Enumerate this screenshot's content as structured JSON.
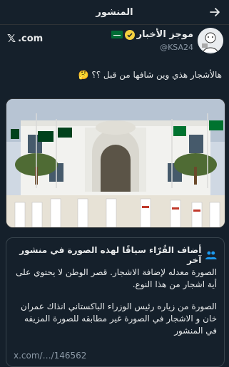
{
  "topbar": {
    "title": "المنشور"
  },
  "author": {
    "name": "موجز الأخبار",
    "handle": "@KSA24"
  },
  "xlink": {
    "label": ".com"
  },
  "tweet": {
    "text": "هالأشجار هذي وين شافها من قبل ؟؟ 🤔"
  },
  "note": {
    "title": "أضاف القُرّاء سياقًا لهذه الصورة في منشور آخر",
    "paragraph1": "الصورة معدله لإضافة الاشجار. قصر الوطن لا يحتوي على أية اشجار من هذا النوع.",
    "paragraph2": "الصورة من زياره رئيس الوزراء الباكستاني انذاك عمران خان و الاشجار في الصورة غير مطابقه للصورة المزيفه في المنشور",
    "link": "x.com/…/146562"
  },
  "colors": {
    "background": "#15202b",
    "text": "#e7e9ea",
    "muted": "#8b98a5",
    "verified": "#f4d03f"
  },
  "icons": [
    "back-arrow-icon",
    "verified-badge-icon",
    "saudi-flag-icon",
    "x-logo-icon",
    "people-icon"
  ]
}
